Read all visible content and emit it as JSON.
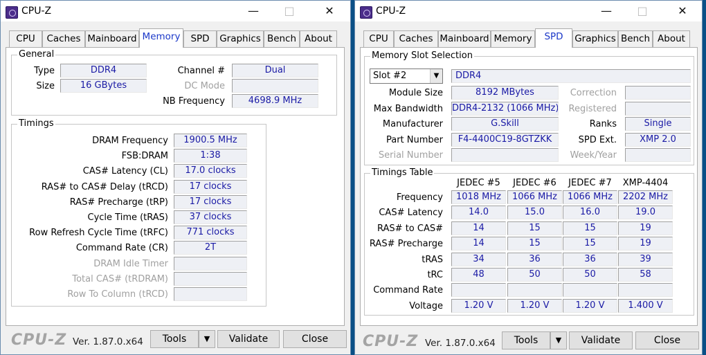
{
  "left": {
    "title": "CPU-Z",
    "tabs": [
      "CPU",
      "Caches",
      "Mainboard",
      "Memory",
      "SPD",
      "Graphics",
      "Bench",
      "About"
    ],
    "active_tab": "Memory",
    "general": {
      "title": "General",
      "type_label": "Type",
      "type_value": "DDR4",
      "size_label": "Size",
      "size_value": "16 GBytes",
      "channel_label": "Channel #",
      "channel_value": "Dual",
      "dcmode_label": "DC Mode",
      "dcmode_value": "",
      "nbfreq_label": "NB Frequency",
      "nbfreq_value": "4698.9 MHz"
    },
    "timings": {
      "title": "Timings",
      "rows": [
        {
          "label": "DRAM Frequency",
          "value": "1900.5 MHz",
          "dim": false
        },
        {
          "label": "FSB:DRAM",
          "value": "1:38",
          "dim": false
        },
        {
          "label": "CAS# Latency (CL)",
          "value": "17.0 clocks",
          "dim": false
        },
        {
          "label": "RAS# to CAS# Delay (tRCD)",
          "value": "17 clocks",
          "dim": false
        },
        {
          "label": "RAS# Precharge (tRP)",
          "value": "17 clocks",
          "dim": false
        },
        {
          "label": "Cycle Time (tRAS)",
          "value": "37 clocks",
          "dim": false
        },
        {
          "label": "Row Refresh Cycle Time (tRFC)",
          "value": "771 clocks",
          "dim": false
        },
        {
          "label": "Command Rate (CR)",
          "value": "2T",
          "dim": false
        },
        {
          "label": "DRAM Idle Timer",
          "value": "",
          "dim": true
        },
        {
          "label": "Total CAS# (tRDRAM)",
          "value": "",
          "dim": true
        },
        {
          "label": "Row To Column (tRCD)",
          "value": "",
          "dim": true
        }
      ]
    },
    "footer": {
      "logo": "CPU-Z",
      "version": "Ver. 1.87.0.x64",
      "tools": "Tools",
      "validate": "Validate",
      "close": "Close"
    }
  },
  "right": {
    "title": "CPU-Z",
    "tabs": [
      "CPU",
      "Caches",
      "Mainboard",
      "Memory",
      "SPD",
      "Graphics",
      "Bench",
      "About"
    ],
    "active_tab": "SPD",
    "slot": {
      "title": "Memory Slot Selection",
      "slot_value": "Slot #2",
      "type_value": "DDR4",
      "module_size_label": "Module Size",
      "module_size_value": "8192 MBytes",
      "max_bw_label": "Max Bandwidth",
      "max_bw_value": "DDR4-2132 (1066 MHz)",
      "manufacturer_label": "Manufacturer",
      "manufacturer_value": "G.Skill",
      "part_label": "Part Number",
      "part_value": "F4-4400C19-8GTZKK",
      "serial_label": "Serial Number",
      "serial_value": "",
      "correction_label": "Correction",
      "correction_value": "",
      "registered_label": "Registered",
      "registered_value": "",
      "ranks_label": "Ranks",
      "ranks_value": "Single",
      "spdext_label": "SPD Ext.",
      "spdext_value": "XMP 2.0",
      "weekyear_label": "Week/Year",
      "weekyear_value": ""
    },
    "timings_table": {
      "title": "Timings Table",
      "columns": [
        "JEDEC #5",
        "JEDEC #6",
        "JEDEC #7",
        "XMP-4404"
      ],
      "rows": [
        {
          "label": "Frequency",
          "values": [
            "1018 MHz",
            "1066 MHz",
            "1066 MHz",
            "2202 MHz"
          ]
        },
        {
          "label": "CAS# Latency",
          "values": [
            "14.0",
            "15.0",
            "16.0",
            "19.0"
          ]
        },
        {
          "label": "RAS# to CAS#",
          "values": [
            "14",
            "15",
            "15",
            "19"
          ]
        },
        {
          "label": "RAS# Precharge",
          "values": [
            "14",
            "15",
            "15",
            "19"
          ]
        },
        {
          "label": "tRAS",
          "values": [
            "34",
            "36",
            "36",
            "39"
          ]
        },
        {
          "label": "tRC",
          "values": [
            "48",
            "50",
            "50",
            "58"
          ]
        },
        {
          "label": "Command Rate",
          "values": [
            "",
            "",
            "",
            ""
          ]
        },
        {
          "label": "Voltage",
          "values": [
            "1.20 V",
            "1.20 V",
            "1.20 V",
            "1.400 V"
          ]
        }
      ]
    },
    "footer": {
      "logo": "CPU-Z",
      "version": "Ver. 1.87.0.x64",
      "tools": "Tools",
      "validate": "Validate",
      "close": "Close"
    }
  }
}
